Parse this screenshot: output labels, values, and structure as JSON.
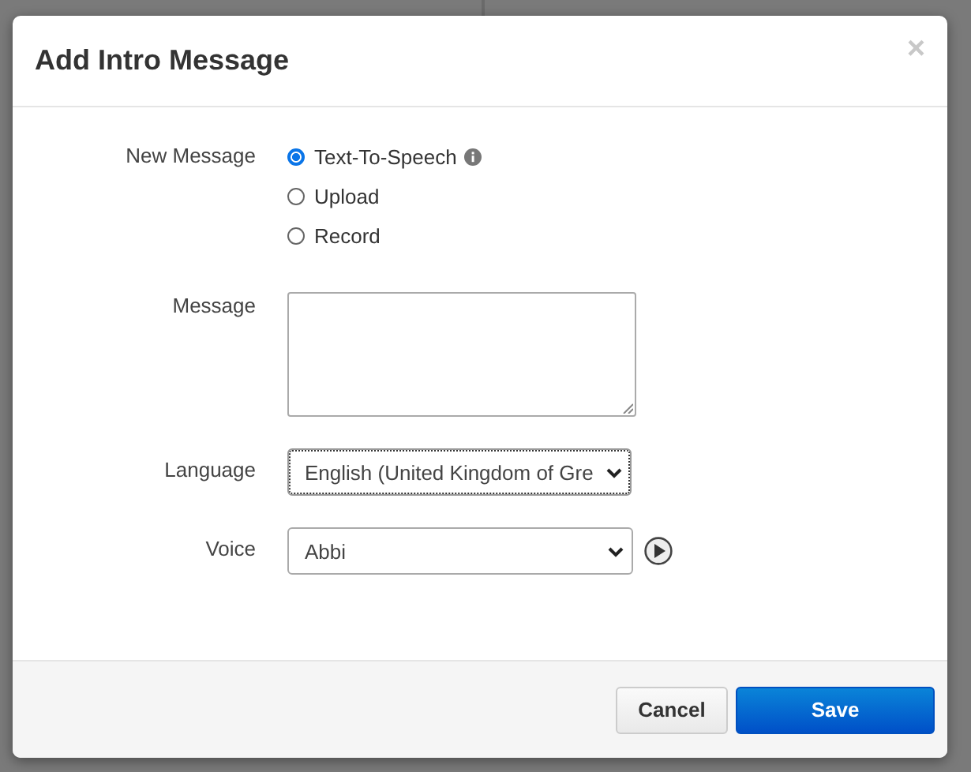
{
  "dialog": {
    "title": "Add Intro Message",
    "close": "×"
  },
  "new_message": {
    "label": "New Message",
    "options": [
      {
        "label": "Text-To-Speech",
        "selected": true,
        "info": true
      },
      {
        "label": "Upload",
        "selected": false,
        "info": false
      },
      {
        "label": "Record",
        "selected": false,
        "info": false
      }
    ]
  },
  "message": {
    "label": "Message"
  },
  "language": {
    "label": "Language",
    "value": "English (United Kingdom of Gre"
  },
  "voice": {
    "label": "Voice",
    "value": "Abbi"
  },
  "buttons": [
    {
      "label": "Cancel",
      "kind": "secondary"
    },
    {
      "label": "Save",
      "kind": "primary"
    }
  ]
}
